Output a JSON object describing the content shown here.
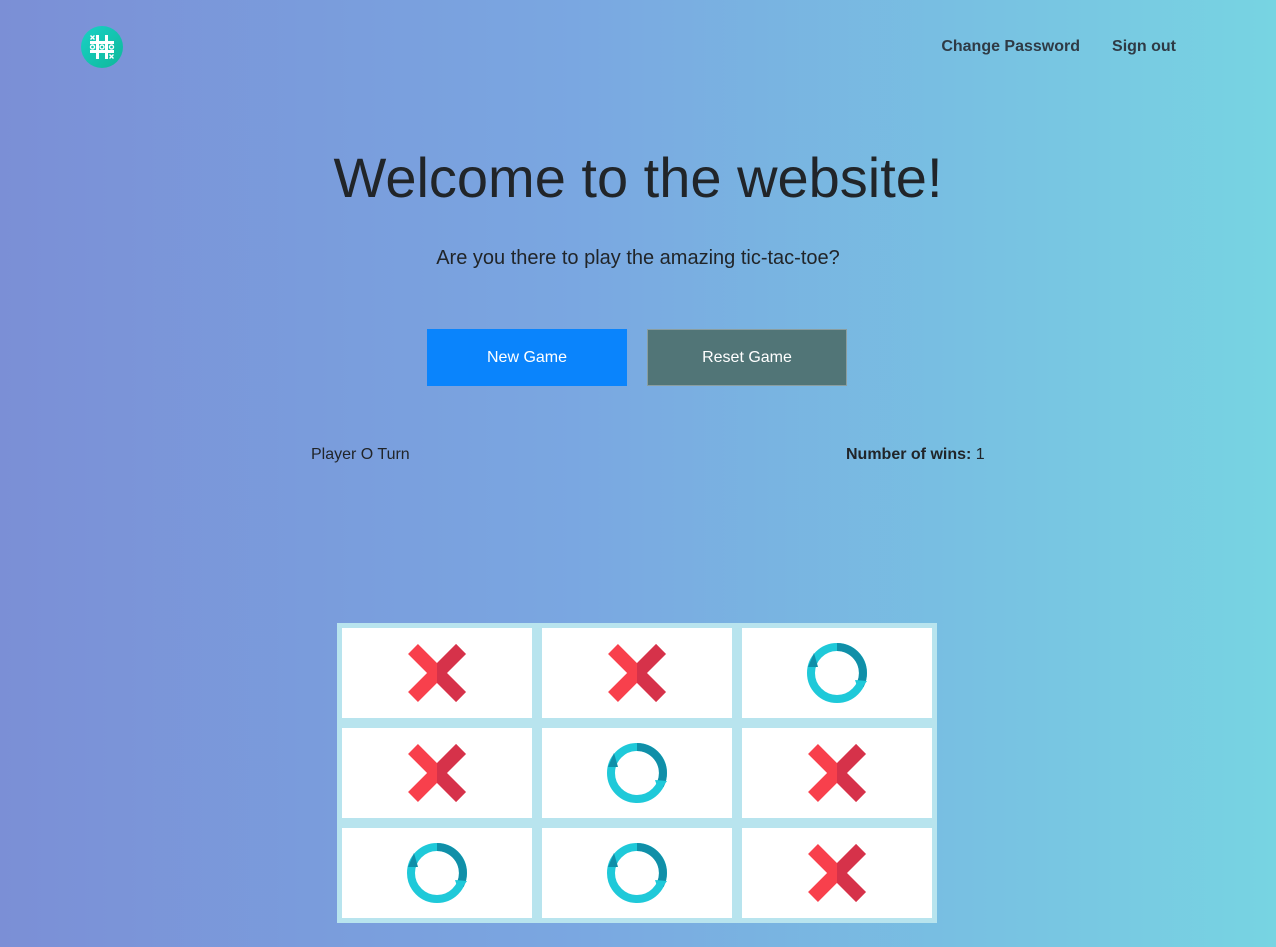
{
  "nav": {
    "logo_icon": "tic-tac-toe-logo",
    "links": [
      "Change Password",
      "Sign out"
    ]
  },
  "hero": {
    "title": "Welcome to the website!",
    "subtitle": "Are you there to play the amazing tic-tac-toe?"
  },
  "buttons": {
    "new_game": "New Game",
    "reset_game": "Reset Game"
  },
  "status": {
    "turn": "Player O Turn",
    "wins_label": "Number of wins:",
    "wins_value": "1"
  },
  "board": [
    [
      "X",
      "X",
      "O"
    ],
    [
      "X",
      "O",
      "X"
    ],
    [
      "O",
      "O",
      "X"
    ]
  ],
  "colors": {
    "x_light": "#f8404c",
    "x_dark": "#d6324a",
    "o_light": "#1fc9d9",
    "o_dark": "#108fa8",
    "primary_button": "#0a84fc",
    "secondary_button": "#517577"
  }
}
